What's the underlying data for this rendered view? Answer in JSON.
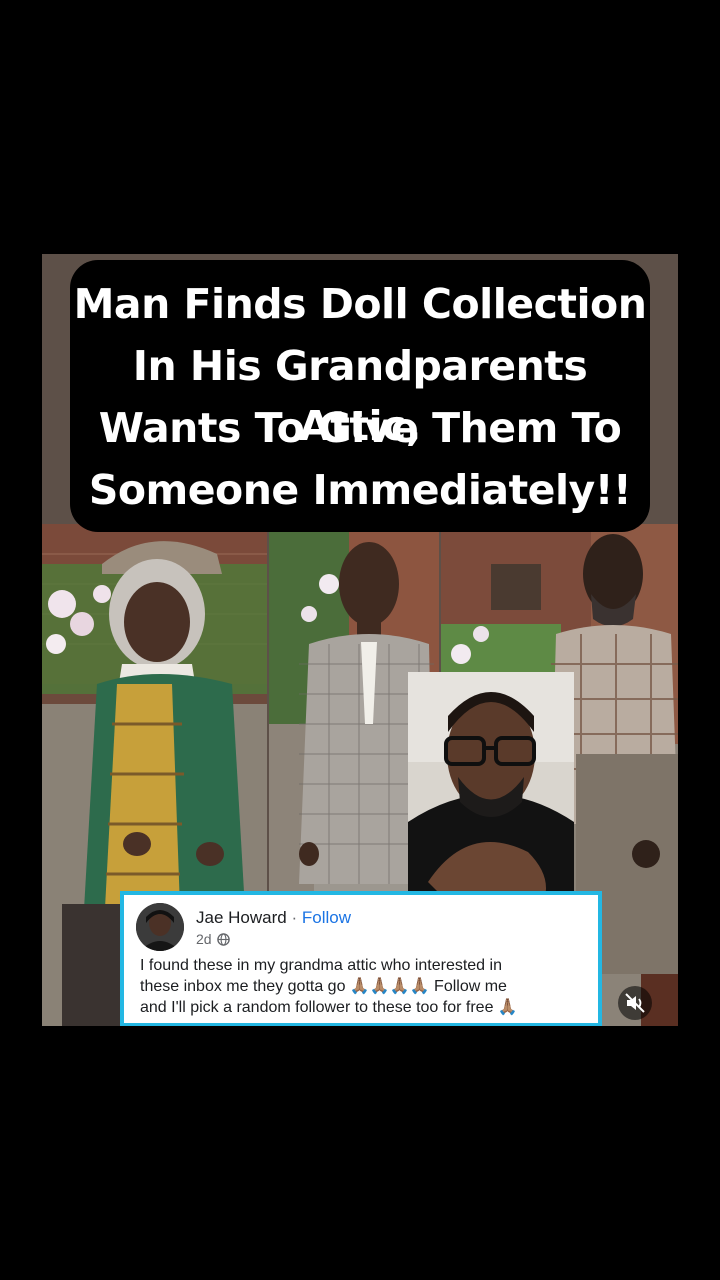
{
  "headline": {
    "line1": "Man Finds Doll Collection",
    "line2": "In His Grandparents Attic,",
    "line3": "Wants To Give Them To",
    "line4": "Someone Immediately!!"
  },
  "post": {
    "author": "Jae Howard",
    "separator": "·",
    "follow_label": "Follow",
    "time": "2d",
    "audience_icon": "globe-icon",
    "text_line1": "I found these in my grandma attic who interested in",
    "text_line2": "these inbox me they gotta go 🙏🏽🙏🏽🙏🏽🙏🏽 Follow me",
    "text_line3": "and I'll pick a random follower to these too for free 🙏🏽"
  },
  "controls": {
    "mute_icon": "muted-speaker-icon"
  },
  "colors": {
    "card_border": "#23b7e3",
    "follow_link": "#1b74e4",
    "headline_bg": "#000000"
  }
}
